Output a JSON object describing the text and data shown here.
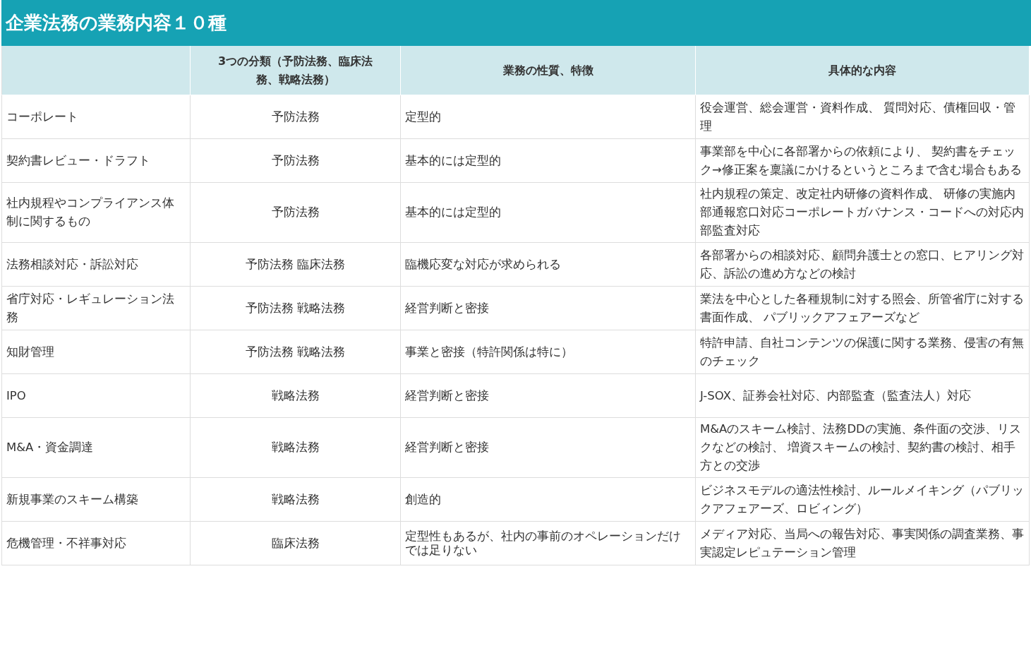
{
  "title": "企業法務の業務内容１０種",
  "table": {
    "columns": [
      "",
      "3つの分類（予防法務、臨床法務、戦略法務）",
      "業務の性質、特徴",
      "具体的な内容"
    ],
    "rows": [
      [
        "コーポレート",
        "予防法務",
        "定型的",
        "役会運営、総会運営・資料作成、 質問対応、債権回収・管理"
      ],
      [
        "契約書レビュー・ドラフト",
        "予防法務",
        "基本的には定型的",
        "事業部を中心に各部署からの依頼により、 契約書をチェック→修正案を稟議にかけるというところまで含む場合もある"
      ],
      [
        "社内規程やコンプライアンス体制に関するもの",
        "予防法務",
        "基本的には定型的",
        "社内規程の策定、改定社内研修の資料作成、 研修の実施内部通報窓口対応コーポレートガバナンス・コードへの対応内部監査対応"
      ],
      [
        "法務相談対応・訴訟対応",
        "予防法務 臨床法務",
        "臨機応変な対応が求められる",
        "各部署からの相談対応、顧問弁護士との窓口、ヒアリング対応、訴訟の進め方などの検討"
      ],
      [
        "省庁対応・レギュレーション法務",
        "予防法務 戦略法務",
        "経営判断と密接",
        "業法を中心とした各種規制に対する照会、所管省庁に対する書面作成、 パブリックアフェアーズなど"
      ],
      [
        "知財管理",
        "予防法務 戦略法務",
        "事業と密接（特許関係は特に）",
        "特許申請、自社コンテンツの保護に関する業務、侵害の有無のチェック"
      ],
      [
        "IPO",
        "戦略法務",
        "経営判断と密接",
        "J-SOX、証券会社対応、内部監査（監査法人）対応"
      ],
      [
        "M&A・資金調達",
        "戦略法務",
        "経営判断と密接",
        "M&Aのスキーム検討、法務DDの実施、条件面の交渉、リスクなどの検討、 増資スキームの検討、契約書の検討、相手方との交渉"
      ],
      [
        "新規事業のスキーム構築",
        "戦略法務",
        "創造的",
        "ビジネスモデルの適法性検討、ルールメイキング（パブリックアフェアーズ、ロビィング）"
      ],
      [
        "危機管理・不祥事対応",
        "臨床法務",
        "定型性もあるが、社内の事前のオペレーションだけでは足りない",
        "メディア対応、当局への報告対応、事実関係の調査業務、事実認定レピュテーション管理"
      ]
    ]
  }
}
